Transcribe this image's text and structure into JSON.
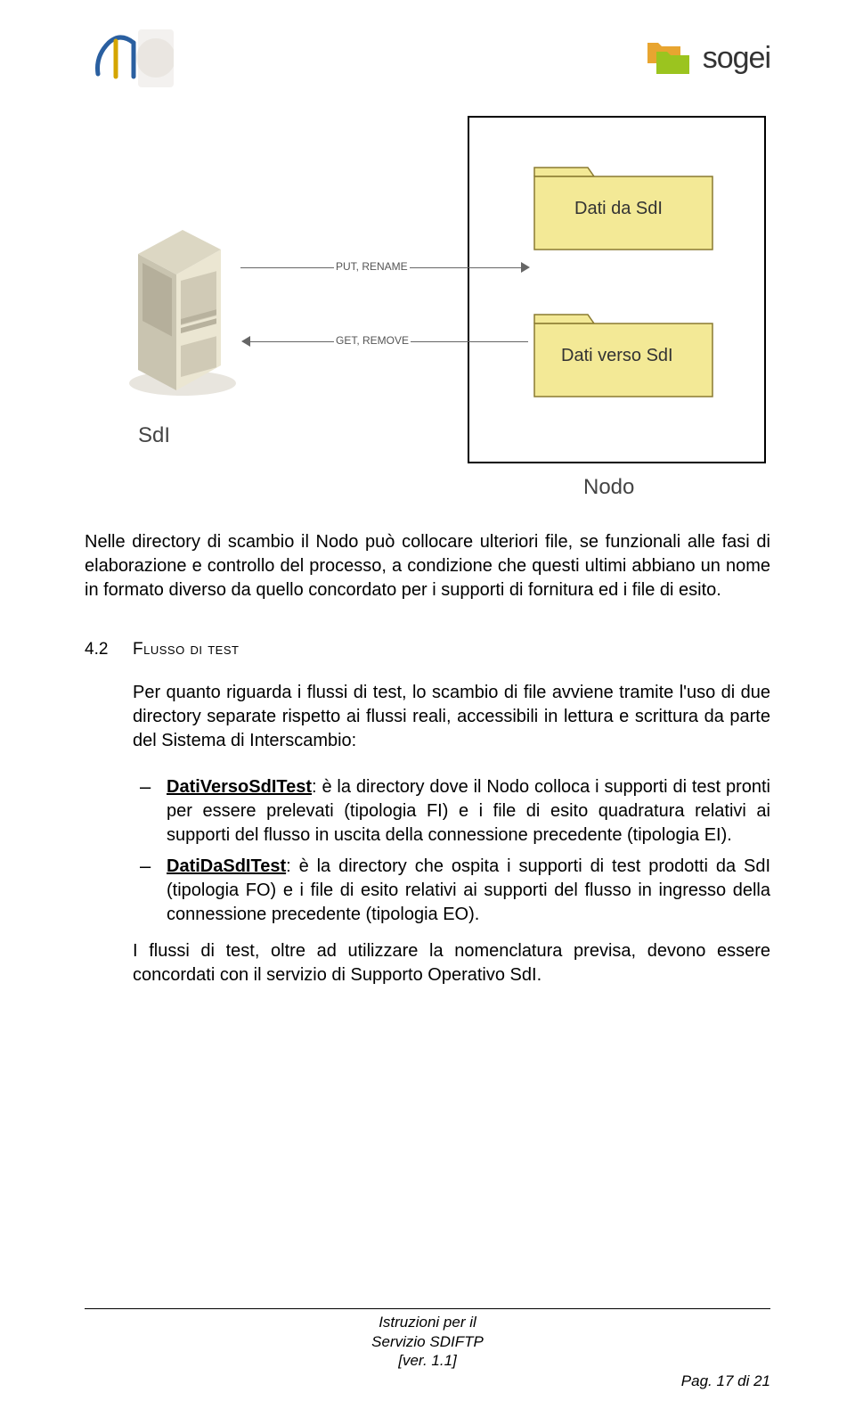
{
  "header": {
    "brand_right": "sogei"
  },
  "diagram": {
    "server_label": "SdI",
    "nodo_label": "Nodo",
    "folder1_label": "Dati da SdI",
    "folder2_label": "Dati verso SdI",
    "arrow1_label": "PUT, RENAME",
    "arrow2_label": "GET, REMOVE"
  },
  "paragraph1": "Nelle directory di scambio il Nodo può collocare ulteriori file, se funzionali alle fasi di elaborazione e controllo del processo, a condizione che questi ultimi abbiano un nome in formato diverso da quello concordato per i supporti di fornitura ed i file di esito.",
  "section": {
    "num": "4.2",
    "title": "Flusso di test"
  },
  "paragraph2": "Per quanto riguarda i flussi di test, lo scambio di file avviene tramite l'uso di due directory separate rispetto ai flussi reali, accessibili in lettura e scrittura da parte del Sistema di Interscambio:",
  "bullets": [
    {
      "term": "DatiVersoSdITest",
      "rest": ": è la directory dove il Nodo colloca i supporti di test pronti per essere prelevati (tipologia FI) e i file di esito quadratura relativi ai supporti del flusso in uscita della connessione precedente (tipologia EI)."
    },
    {
      "term": "DatiDaSdITest",
      "rest": ": è la directory che ospita i supporti di test prodotti da SdI (tipologia FO) e i file di esito relativi ai supporti del flusso in ingresso della connessione precedente (tipologia EO)."
    }
  ],
  "closing": "I flussi di test, oltre ad utilizzare la nomenclatura previsa, devono essere concordati con il servizio di Supporto Operativo SdI.",
  "footer": {
    "line1": "Istruzioni per il",
    "line2": "Servizio SDIFTP",
    "line3": "[ver. 1.1]",
    "page": "Pag. 17 di 21"
  }
}
